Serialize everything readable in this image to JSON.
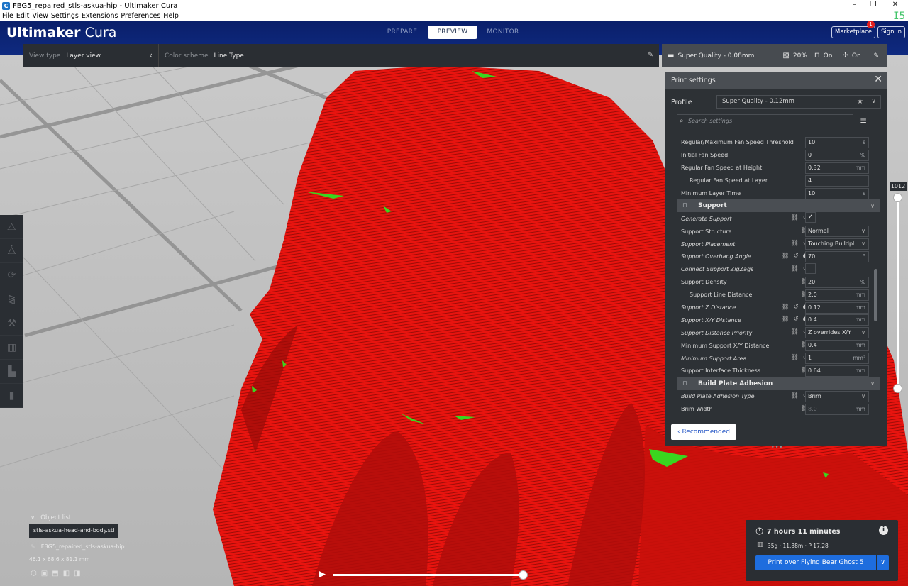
{
  "window": {
    "title": "FBG5_repaired_stls-askua-hip - Ultimaker Cura",
    "app_icon": "C",
    "controls": [
      "–",
      "❐",
      "✕"
    ],
    "version_mark": "I5"
  },
  "menu": [
    "File",
    "Edit",
    "View",
    "Settings",
    "Extensions",
    "Preferences",
    "Help"
  ],
  "header": {
    "brand_bold": "Ultimaker",
    "brand_light": "Cura",
    "stages": [
      "PREPARE",
      "PREVIEW",
      "MONITOR"
    ],
    "active_stage": "PREVIEW",
    "marketplace": "Marketplace",
    "marketplace_badge": "1",
    "signin": "Sign in"
  },
  "viewbar": {
    "view_type_label": "View type",
    "view_type_value": "Layer view",
    "color_scheme_label": "Color scheme",
    "color_scheme_value": "Line Type"
  },
  "qualbar": {
    "quality": "Super Quality - 0.08mm",
    "infill": "20%",
    "support": "On",
    "adhesion": "On"
  },
  "print_settings": {
    "title": "Print settings",
    "profile_label": "Profile",
    "profile_value": "Super Quality - 0.12mm",
    "search_placeholder": "Search settings",
    "recommended": "Recommended",
    "rows": [
      {
        "kind": "setting",
        "label": "Regular/Maximum Fan Speed Threshold",
        "value": "10",
        "unit": "s"
      },
      {
        "kind": "setting",
        "label": "Initial Fan Speed",
        "value": "0",
        "unit": "%"
      },
      {
        "kind": "setting",
        "label": "Regular Fan Speed at Height",
        "value": "0.32",
        "unit": "mm"
      },
      {
        "kind": "setting",
        "label": "Regular Fan Speed at Layer",
        "value": "4",
        "unit": "",
        "indent": true
      },
      {
        "kind": "setting",
        "label": "Minimum Layer Time",
        "value": "10",
        "unit": "s"
      },
      {
        "kind": "category",
        "label": "Support"
      },
      {
        "kind": "check",
        "label": "Generate Support",
        "italic": true,
        "icons": [
          "link",
          "reset"
        ],
        "checked": true
      },
      {
        "kind": "select",
        "label": "Support Structure",
        "value": "Normal",
        "icons": [
          "link"
        ]
      },
      {
        "kind": "select",
        "label": "Support Placement",
        "value": "Touching Buildpl...",
        "italic": true,
        "icons": [
          "link",
          "reset"
        ]
      },
      {
        "kind": "setting",
        "label": "Support Overhang Angle",
        "value": "70",
        "unit": "°",
        "italic": true,
        "icons": [
          "link",
          "reset",
          "fx"
        ]
      },
      {
        "kind": "check",
        "label": "Connect Support ZigZags",
        "italic": true,
        "icons": [
          "link",
          "reset"
        ],
        "checked": false
      },
      {
        "kind": "setting",
        "label": "Support Density",
        "value": "20",
        "unit": "%",
        "icons": [
          "link"
        ]
      },
      {
        "kind": "setting",
        "label": "Support Line Distance",
        "value": "2.0",
        "unit": "mm",
        "indent": true,
        "icons": [
          "link"
        ]
      },
      {
        "kind": "setting",
        "label": "Support Z Distance",
        "value": "0.12",
        "unit": "mm",
        "italic": true,
        "icons": [
          "link",
          "reset",
          "fx"
        ]
      },
      {
        "kind": "setting",
        "label": "Support X/Y Distance",
        "value": "0.4",
        "unit": "mm",
        "italic": true,
        "icons": [
          "link",
          "reset",
          "fx"
        ]
      },
      {
        "kind": "select",
        "label": "Support Distance Priority",
        "value": "Z overrides X/Y",
        "italic": true,
        "icons": [
          "link",
          "reset"
        ]
      },
      {
        "kind": "setting",
        "label": "Minimum Support X/Y Distance",
        "value": "0.4",
        "unit": "mm",
        "icons": [
          "link"
        ]
      },
      {
        "kind": "setting",
        "label": "Minimum Support Area",
        "value": "1",
        "unit": "mm²",
        "italic": true,
        "icons": [
          "link",
          "reset"
        ]
      },
      {
        "kind": "setting",
        "label": "Support Interface Thickness",
        "value": "0.64",
        "unit": "mm",
        "icons": [
          "link"
        ]
      },
      {
        "kind": "category",
        "label": "Build Plate Adhesion"
      },
      {
        "kind": "select",
        "label": "Build Plate Adhesion Type",
        "value": "Brim",
        "italic": true,
        "icons": [
          "link",
          "reset"
        ]
      },
      {
        "kind": "setting",
        "label": "Brim Width",
        "value": "8.0",
        "unit": "mm",
        "dim": true,
        "icons": [
          "link"
        ]
      }
    ]
  },
  "layer_slider": {
    "value": "1012",
    "fraction": 1.0
  },
  "object_list": {
    "toggle_label": "Object list",
    "item": "stls-askua-head-and-body.stl",
    "file": "FBG5_repaired_stls-askua-hip",
    "dims": "46.1 x 68.6 x 81.1 mm"
  },
  "playback": {
    "position_fraction": 1.0
  },
  "print_panel": {
    "time": "7 hours 11 minutes",
    "material": "35g · 11.88m · P 17.28",
    "button": "Print over Flying Bear Ghost 5"
  },
  "colors": {
    "header": "#0f2a80",
    "model": "#e8140f",
    "accent": "#1e6dde",
    "panel": "#2d3135"
  }
}
